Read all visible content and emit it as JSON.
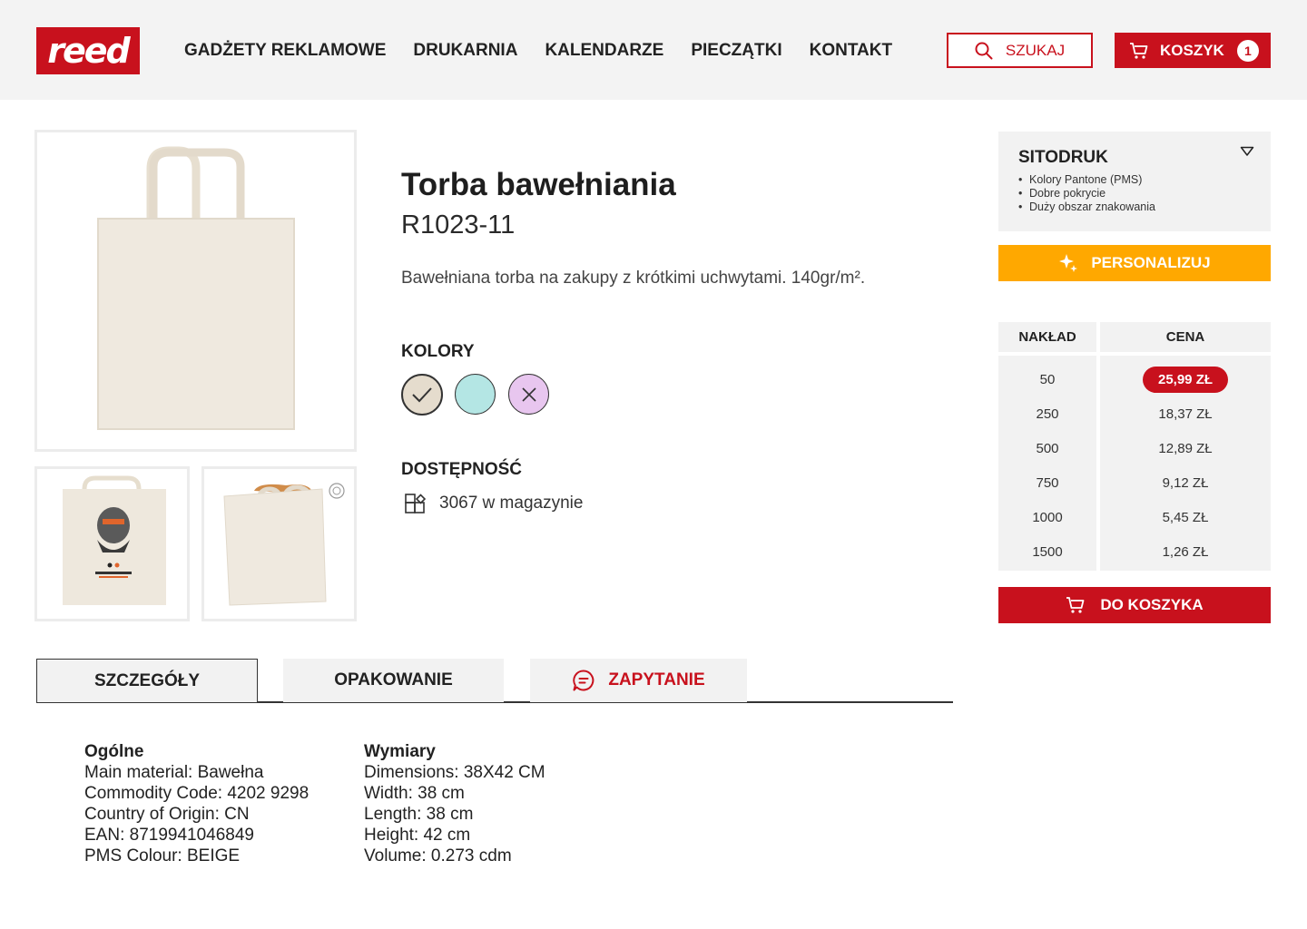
{
  "header": {
    "logo_text": "reed",
    "nav": [
      "GADŻETY REKLAMOWE",
      "DRUKARNIA",
      "KALENDARZE",
      "PIECZĄTKI",
      "KONTAKT"
    ],
    "search_label": "SZUKAJ",
    "cart_label": "KOSZYK",
    "cart_count": "1",
    "accent_color": "#c8111d"
  },
  "product": {
    "title": "Torba bawełniania",
    "sku": "R1023-11",
    "description": "Bawełniana torba na zakupy z krótkimi uchwytami. 140gr/m².",
    "colors_heading": "KOLORY",
    "colors": [
      {
        "color": "#e5dccd",
        "state": "selected",
        "icon": "check-icon"
      },
      {
        "color": "#b4e6e4",
        "state": "available"
      },
      {
        "color": "#e8c6ef",
        "state": "unavailable",
        "icon": "cross-icon"
      }
    ],
    "availability_heading": "DOSTĘPNOŚĆ",
    "stock_text": "3067 w magazynie",
    "images": [
      "main-bag-image",
      "printed-bag-thumbnail",
      "filled-bag-thumbnail"
    ]
  },
  "sidebar": {
    "print_method": "SITODRUK",
    "print_features": [
      "Kolory Pantone (PMS)",
      "Dobre pokrycie",
      "Duży obszar znakowania"
    ],
    "personalize_label": "PERSONALIZUJ",
    "price_table": {
      "qty_header": "NAKŁAD",
      "price_header": "CENA",
      "rows": [
        {
          "qty": "50",
          "price": "25,99 ZŁ",
          "active": true
        },
        {
          "qty": "250",
          "price": "18,37 ZŁ"
        },
        {
          "qty": "500",
          "price": "12,89 ZŁ"
        },
        {
          "qty": "750",
          "price": "9,12 ZŁ"
        },
        {
          "qty": "1000",
          "price": "5,45 ZŁ"
        },
        {
          "qty": "1500",
          "price": "1,26 ZŁ"
        }
      ]
    },
    "add_to_cart_label": "DO KOSZYKA"
  },
  "tabs": [
    "SZCZEGÓŁY",
    "OPAKOWANIE",
    "ZAPYTANIE"
  ],
  "details": {
    "general": {
      "heading": "Ogólne",
      "lines": [
        "Main material: Bawełna",
        "Commodity Code: 4202 9298",
        "Country of Origin: CN",
        "EAN: 8719941046849",
        "PMS Colour: BEIGE"
      ]
    },
    "dimensions": {
      "heading": "Wymiary",
      "lines": [
        "Dimensions: 38X42 CM",
        "Width: 38 cm",
        "Length: 38 cm",
        "Height: 42 cm",
        "Volume: 0.273 cdm"
      ]
    }
  }
}
